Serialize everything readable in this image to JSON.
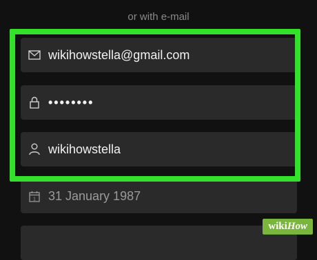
{
  "form": {
    "separator_text": "or with e-mail",
    "email_value": "wikihowstella@gmail.com",
    "password_value": "••••••••",
    "username_value": "wikihowstella",
    "birthdate_value": "31 January 1987",
    "last_field_value": ""
  },
  "icons": {
    "email": "envelope-icon",
    "password": "lock-icon",
    "username": "user-icon",
    "birthdate": "calendar-icon"
  },
  "colors": {
    "background": "#111111",
    "field_bg": "#2a2a2a",
    "highlight": "#33e02a"
  },
  "watermark": {
    "wiki": "wiki",
    "how": "How"
  }
}
